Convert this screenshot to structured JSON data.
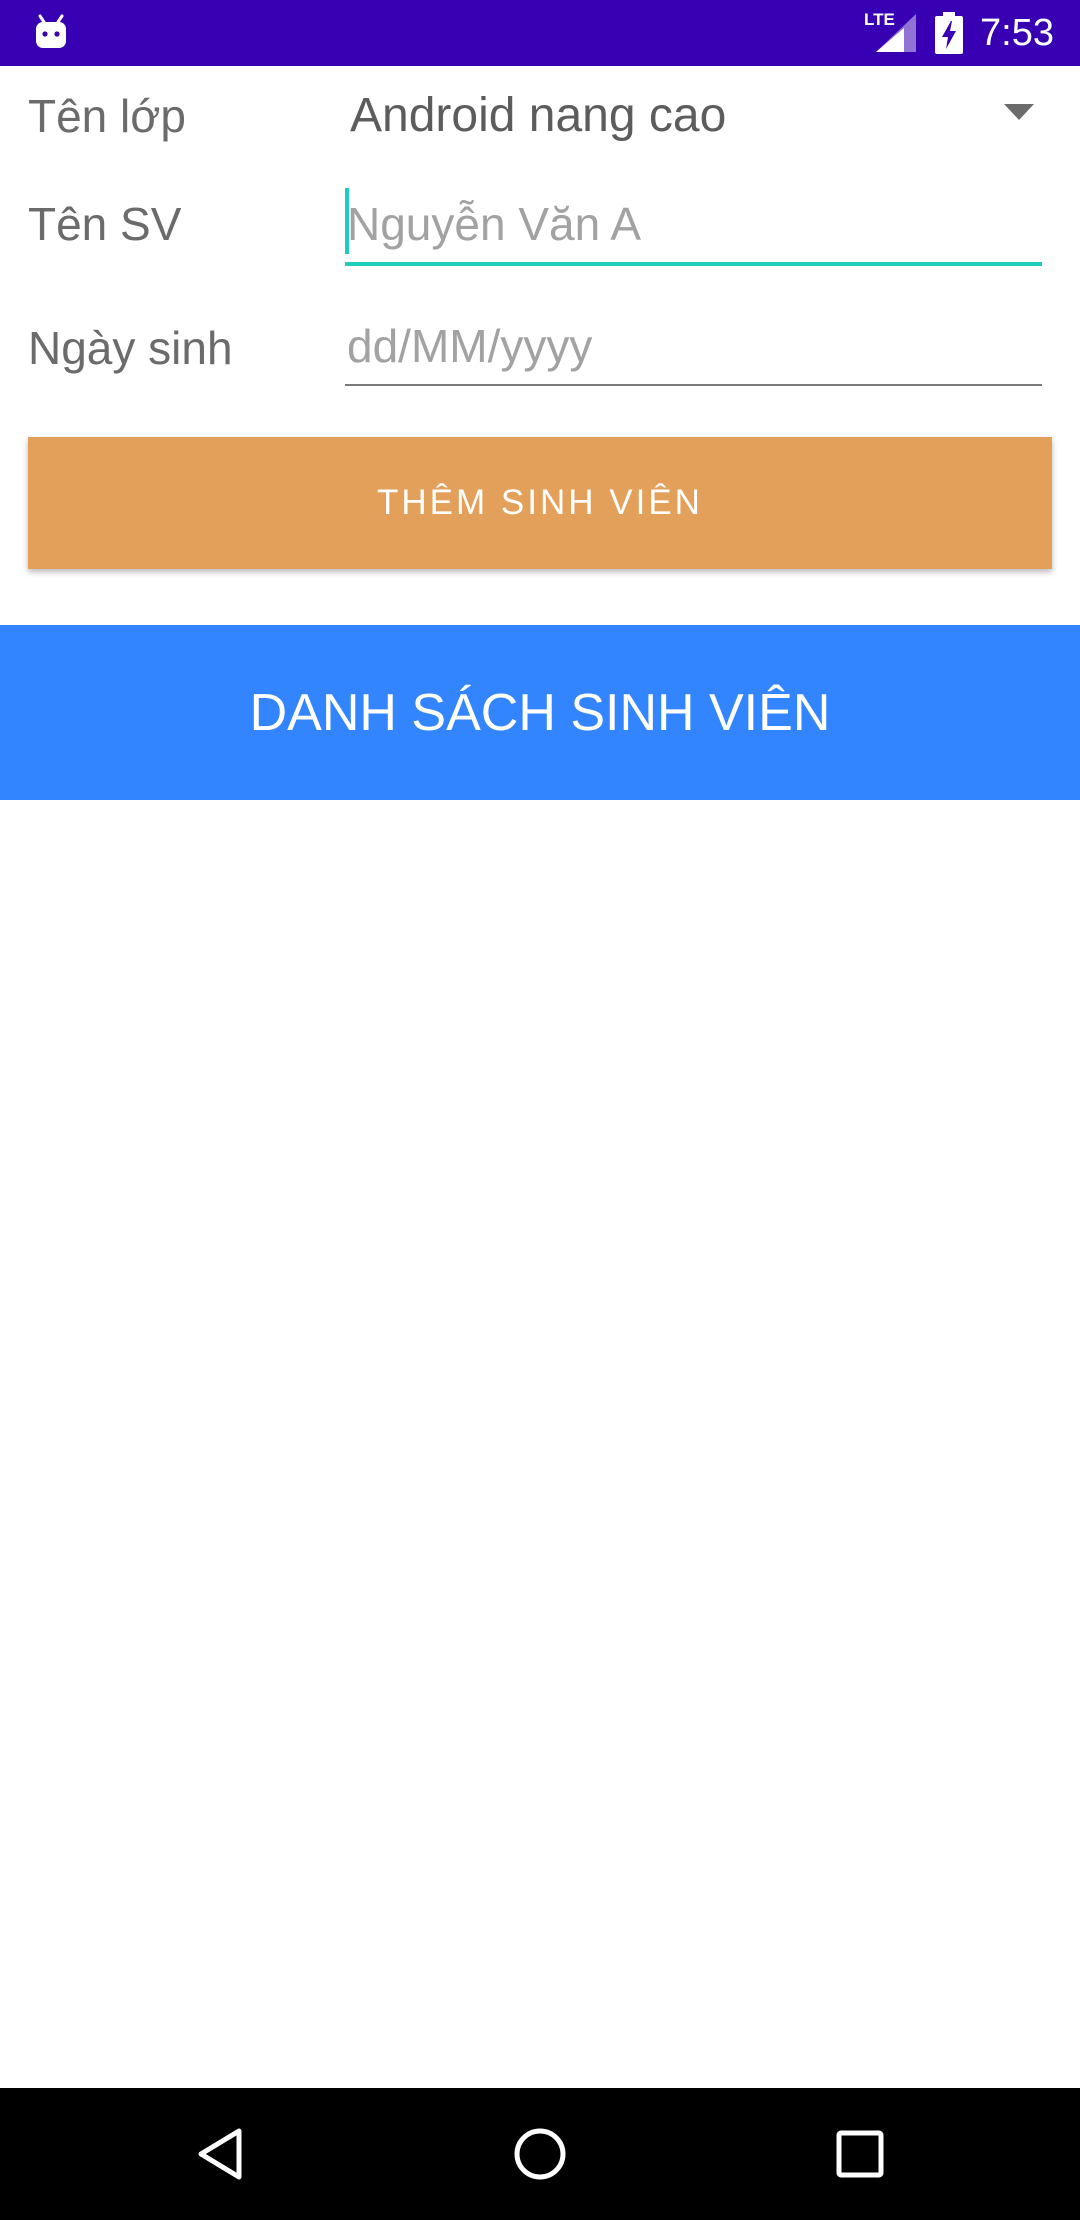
{
  "status_bar": {
    "time": "7:53",
    "network_label": "LTE",
    "left_icon": "android-debug-icon",
    "colors": {
      "background": "#3700b3"
    }
  },
  "form": {
    "class_row": {
      "label": "Tên lớp",
      "selected_value": "Android nang cao"
    },
    "name_row": {
      "label": "Tên SV",
      "value": "",
      "placeholder": "Nguyễn Văn A"
    },
    "dob_row": {
      "label": "Ngày sinh",
      "value": "",
      "placeholder": "dd/MM/yyyy"
    },
    "focus_color": "#1ecbbf"
  },
  "add_button": {
    "label": "THÊM SINH VIÊN",
    "color": "#e3a05a"
  },
  "list": {
    "header": "DANH SÁCH SINH VIÊN",
    "header_color": "#3385ff",
    "items": []
  },
  "nav_bar": {
    "back_icon": "back-icon",
    "home_icon": "home-icon",
    "recents_icon": "recents-icon"
  }
}
